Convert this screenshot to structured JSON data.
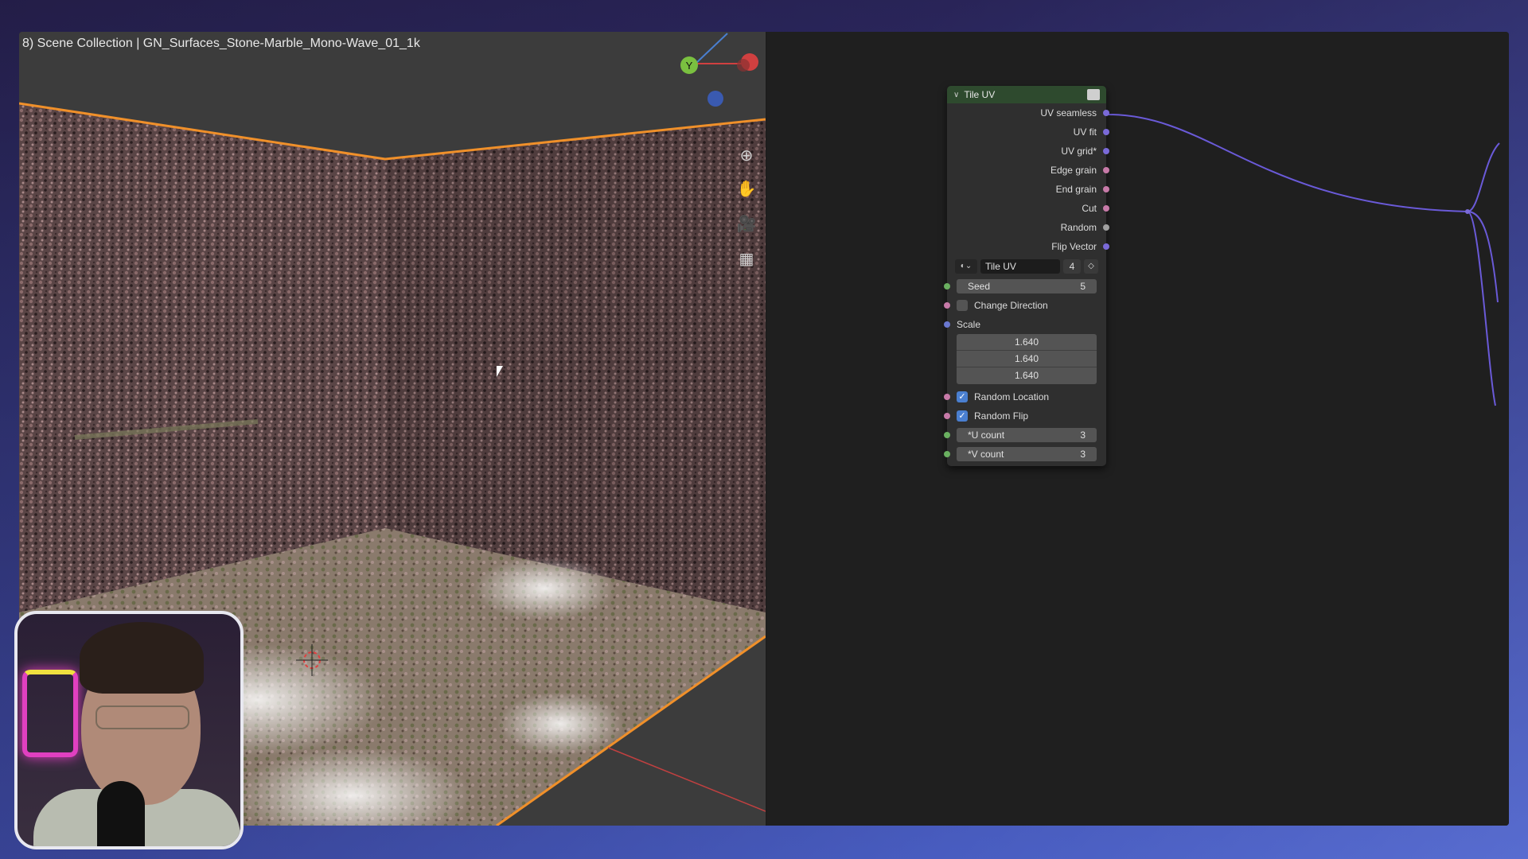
{
  "viewport": {
    "header": "8) Scene Collection | GN_Surfaces_Stone-Marble_Mono-Wave_01_1k",
    "gizmo": {
      "y_label": "Y"
    },
    "tools": [
      "zoom-icon",
      "pan-hand-icon",
      "camera-icon",
      "grid-icon"
    ]
  },
  "node": {
    "title": "Tile UV",
    "outputs": [
      {
        "label": "UV seamless",
        "socket": "purple"
      },
      {
        "label": "UV fit",
        "socket": "purple"
      },
      {
        "label": "UV grid*",
        "socket": "purple"
      },
      {
        "label": "Edge grain",
        "socket": "pink"
      },
      {
        "label": "End grain",
        "socket": "pink"
      },
      {
        "label": "Cut",
        "socket": "pink"
      },
      {
        "label": "Random",
        "socket": "grey"
      },
      {
        "label": "Flip Vector",
        "socket": "purple"
      }
    ],
    "group": {
      "name": "Tile UV",
      "users": "4"
    },
    "seed": {
      "label": "Seed",
      "value": "5"
    },
    "change_direction": {
      "label": "Change Direction",
      "checked": false
    },
    "scale": {
      "label": "Scale",
      "values": [
        "1.640",
        "1.640",
        "1.640"
      ]
    },
    "random_location": {
      "label": "Random Location",
      "checked": true
    },
    "random_flip": {
      "label": "Random Flip",
      "checked": true
    },
    "u_count": {
      "label": "*U count",
      "value": "3"
    },
    "v_count": {
      "label": "*V count",
      "value": "3"
    }
  },
  "colors": {
    "node_header": "#2e4a2e",
    "wire": "#6a5ad8",
    "viewport_edge": "#f0902a",
    "background_accent": "#6a7fd8"
  }
}
